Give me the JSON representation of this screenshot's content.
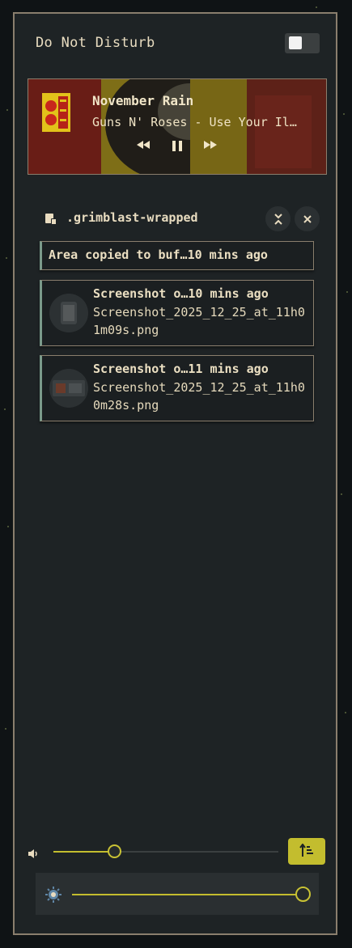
{
  "dnd": {
    "label": "Do Not Disturb",
    "enabled": false
  },
  "media": {
    "title": "November Rain",
    "artist": "Guns N' Roses - Use Your Il…",
    "controls": {
      "previous_icon": "rewind-icon",
      "play_pause_icon": "pause-icon",
      "next_icon": "fast-forward-icon"
    }
  },
  "notification_group": {
    "app_name": ".grimblast-wrapped",
    "collapse_icon": "collapse-icon",
    "close_icon": "close-icon",
    "items": [
      {
        "title": "Area copied to buf…10 mins ago"
      },
      {
        "title": "Screenshot o…10 mins ago",
        "body": "Screenshot_2025_12_25_at_11h01m09s.png"
      },
      {
        "title": "Screenshot o…11 mins ago",
        "body": "Screenshot_2025_12_25_at_11h00m28s.png"
      }
    ]
  },
  "volume": {
    "icon": "speaker-icon",
    "level": 0.27
  },
  "sort_button": {
    "icon": "sort-ascending-icon"
  },
  "brightness": {
    "icon": "brightness-icon",
    "level": 1.0
  },
  "colors": {
    "accent": "#c3bd2e",
    "border": "#8a7e6d",
    "panel": "#1e2325"
  }
}
